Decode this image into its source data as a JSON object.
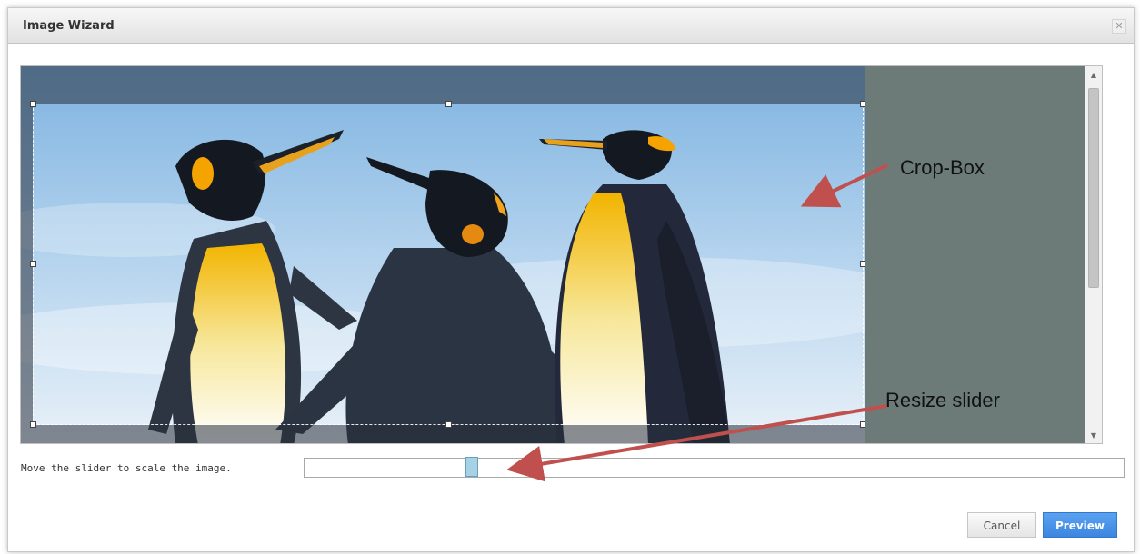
{
  "dialog": {
    "title": "Image Wizard",
    "close_icon": "close-icon"
  },
  "annotations": {
    "crop_box_label": "Crop-Box",
    "resize_slider_label": "Resize slider",
    "arrow_color": "#c0504d"
  },
  "slider": {
    "label": "Move the slider to scale the image.",
    "value_fraction": 0.2
  },
  "buttons": {
    "cancel": "Cancel",
    "preview": "Preview"
  },
  "scrollbar": {
    "up_icon": "chevron-up-icon",
    "down_icon": "chevron-down-icon"
  },
  "colors": {
    "accent": "#3c86e1",
    "viewport_bg": "#6c7b77",
    "slider_thumb": "#a6d2e6"
  }
}
